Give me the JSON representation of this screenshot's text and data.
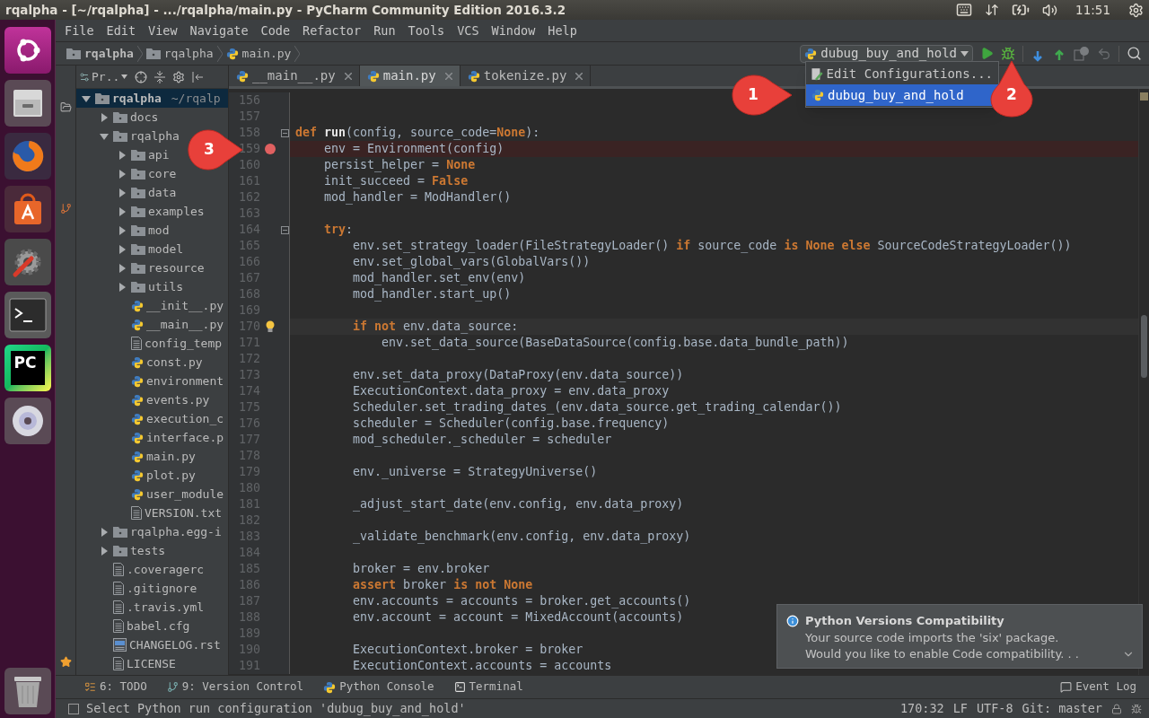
{
  "top_panel": {
    "title": "rqalpha - [~/rqalpha] - .../rqalpha/main.py - PyCharm Community Edition 2016.3.2",
    "clock": "11:51"
  },
  "launcher": {
    "items": [
      {
        "kind": "ubuntu"
      },
      {
        "kind": "files"
      },
      {
        "kind": "browser"
      },
      {
        "kind": "store"
      },
      {
        "kind": "settings"
      },
      {
        "kind": "terminal"
      },
      {
        "kind": "ide",
        "label": "PC"
      },
      {
        "kind": "disc"
      },
      {
        "kind": "trash"
      }
    ]
  },
  "menu": [
    "File",
    "Edit",
    "View",
    "Navigate",
    "Code",
    "Refactor",
    "Run",
    "Tools",
    "VCS",
    "Window",
    "Help"
  ],
  "breadcrumbs": [
    {
      "kind": "root",
      "label": "rqalpha"
    },
    {
      "kind": "folder",
      "label": "rqalpha"
    },
    {
      "kind": "python",
      "label": "main.py"
    }
  ],
  "run_config": {
    "label": "dubug_buy_and_hold"
  },
  "run_menu": [
    {
      "kind": "edit",
      "label": "Edit Configurations...",
      "selected": false
    },
    {
      "kind": "python",
      "label": "dubug_buy_and_hold",
      "selected": true
    }
  ],
  "project": {
    "header": "Pr..",
    "tree": [
      {
        "kind": "folder",
        "name": "rqalpha",
        "hint": "~/rqalp",
        "expanded": true,
        "selected": true,
        "children": [
          {
            "kind": "folder",
            "name": "docs",
            "expanded": false,
            "selected": false
          },
          {
            "kind": "folder",
            "name": "rqalpha",
            "expanded": true,
            "selected": false,
            "children": [
              {
                "kind": "folder",
                "name": "api",
                "expanded": false,
                "selected": false
              },
              {
                "kind": "folder",
                "name": "core",
                "expanded": false,
                "selected": false
              },
              {
                "kind": "folder",
                "name": "data",
                "expanded": false,
                "selected": false
              },
              {
                "kind": "folder",
                "name": "examples",
                "expanded": false,
                "selected": false
              },
              {
                "kind": "folder",
                "name": "mod",
                "expanded": false,
                "selected": false
              },
              {
                "kind": "folder",
                "name": "model",
                "expanded": false,
                "selected": false
              },
              {
                "kind": "folder",
                "name": "resource",
                "expanded": false,
                "selected": false
              },
              {
                "kind": "folder",
                "name": "utils",
                "expanded": false,
                "selected": false
              },
              {
                "kind": "python",
                "name": "__init__.py",
                "selected": false
              },
              {
                "kind": "python",
                "name": "__main__.py",
                "selected": false
              },
              {
                "kind": "text",
                "name": "config_temp",
                "selected": false
              },
              {
                "kind": "python",
                "name": "const.py",
                "selected": false
              },
              {
                "kind": "python",
                "name": "environment",
                "selected": false
              },
              {
                "kind": "python",
                "name": "events.py",
                "selected": false
              },
              {
                "kind": "python",
                "name": "execution_c",
                "selected": false
              },
              {
                "kind": "python",
                "name": "interface.p",
                "selected": false
              },
              {
                "kind": "python",
                "name": "main.py",
                "selected": false
              },
              {
                "kind": "python",
                "name": "plot.py",
                "selected": false
              },
              {
                "kind": "python",
                "name": "user_module",
                "selected": false
              },
              {
                "kind": "text",
                "name": "VERSION.txt",
                "selected": false
              }
            ]
          },
          {
            "kind": "folder",
            "name": "rqalpha.egg-i",
            "expanded": false,
            "selected": false
          },
          {
            "kind": "folder",
            "name": "tests",
            "expanded": false,
            "selected": false
          },
          {
            "kind": "text",
            "name": ".coveragerc",
            "selected": false
          },
          {
            "kind": "text",
            "name": ".gitignore",
            "selected": false
          },
          {
            "kind": "text",
            "name": ".travis.yml",
            "selected": false
          },
          {
            "kind": "text",
            "name": "babel.cfg",
            "selected": false
          },
          {
            "kind": "rst",
            "name": "CHANGELOG.rst",
            "selected": false
          },
          {
            "kind": "text",
            "name": "LICENSE",
            "selected": false
          }
        ]
      }
    ]
  },
  "tabs": [
    {
      "label": "__main__.py",
      "selected": false
    },
    {
      "label": "main.py",
      "selected": true
    },
    {
      "label": "tokenize.py",
      "selected": false
    }
  ],
  "editor": {
    "lines": [
      {
        "number": "156",
        "breakpoint": false,
        "caret": false,
        "fold": false
      },
      {
        "number": "157",
        "breakpoint": false,
        "caret": false,
        "fold": false
      },
      {
        "number": "158",
        "breakpoint": false,
        "caret": false,
        "fold": true,
        "tokens": [
          {
            "kind": "keyword",
            "text": "def "
          },
          {
            "kind": "name",
            "text": "run"
          },
          {
            "kind": "plain",
            "text": "(config, source_code="
          },
          {
            "kind": "keyword",
            "text": "None"
          },
          {
            "kind": "plain",
            "text": "):"
          }
        ]
      },
      {
        "number": "159",
        "breakpoint": true,
        "caret": false,
        "fold": false,
        "tokens": [
          {
            "kind": "plain",
            "text": "    env = Environment(config)"
          }
        ]
      },
      {
        "number": "160",
        "breakpoint": false,
        "caret": false,
        "fold": false,
        "tokens": [
          {
            "kind": "plain",
            "text": "    persist_helper = "
          },
          {
            "kind": "keyword",
            "text": "None"
          }
        ]
      },
      {
        "number": "161",
        "breakpoint": false,
        "caret": false,
        "fold": false,
        "tokens": [
          {
            "kind": "plain",
            "text": "    init_succeed = "
          },
          {
            "kind": "keyword",
            "text": "False"
          }
        ]
      },
      {
        "number": "162",
        "breakpoint": false,
        "caret": false,
        "fold": false,
        "tokens": [
          {
            "kind": "plain",
            "text": "    mod_handler = ModHandler()"
          }
        ]
      },
      {
        "number": "163",
        "breakpoint": false,
        "caret": false,
        "fold": false
      },
      {
        "number": "164",
        "breakpoint": false,
        "caret": false,
        "fold": true,
        "tokens": [
          {
            "kind": "keyword",
            "text": "    try"
          },
          {
            "kind": "plain",
            "text": ":"
          }
        ]
      },
      {
        "number": "165",
        "breakpoint": false,
        "caret": false,
        "fold": false,
        "tokens": [
          {
            "kind": "plain",
            "text": "        env.set_strategy_loader(FileStrategyLoader() "
          },
          {
            "kind": "keyword",
            "text": "if"
          },
          {
            "kind": "plain",
            "text": " source_code "
          },
          {
            "kind": "keyword",
            "text": "is None else"
          },
          {
            "kind": "plain",
            "text": " SourceCodeStrategyLoader())"
          }
        ]
      },
      {
        "number": "166",
        "breakpoint": false,
        "caret": false,
        "fold": false,
        "tokens": [
          {
            "kind": "plain",
            "text": "        env.set_global_vars(GlobalVars())"
          }
        ]
      },
      {
        "number": "167",
        "breakpoint": false,
        "caret": false,
        "fold": false,
        "tokens": [
          {
            "kind": "plain",
            "text": "        mod_handler.set_env(env)"
          }
        ]
      },
      {
        "number": "168",
        "breakpoint": false,
        "caret": false,
        "fold": false,
        "tokens": [
          {
            "kind": "plain",
            "text": "        mod_handler.start_up()"
          }
        ]
      },
      {
        "number": "169",
        "breakpoint": false,
        "caret": false,
        "fold": false
      },
      {
        "number": "170",
        "breakpoint": false,
        "caret": true,
        "fold": false,
        "tokens": [
          {
            "kind": "keyword",
            "text": "        if not"
          },
          {
            "kind": "plain",
            "text": " env.data_source:"
          }
        ]
      },
      {
        "number": "171",
        "breakpoint": false,
        "caret": false,
        "fold": false,
        "tokens": [
          {
            "kind": "plain",
            "text": "            env.set_data_source(BaseDataSource(config.base.data_bundle_path))"
          }
        ]
      },
      {
        "number": "172",
        "breakpoint": false,
        "caret": false,
        "fold": false
      },
      {
        "number": "173",
        "breakpoint": false,
        "caret": false,
        "fold": false,
        "tokens": [
          {
            "kind": "plain",
            "text": "        env.set_data_proxy(DataProxy(env.data_source))"
          }
        ]
      },
      {
        "number": "174",
        "breakpoint": false,
        "caret": false,
        "fold": false,
        "tokens": [
          {
            "kind": "plain",
            "text": "        ExecutionContext.data_proxy = env.data_proxy"
          }
        ]
      },
      {
        "number": "175",
        "breakpoint": false,
        "caret": false,
        "fold": false,
        "tokens": [
          {
            "kind": "plain",
            "text": "        Scheduler.set_trading_dates_(env.data_source.get_trading_calendar())"
          }
        ]
      },
      {
        "number": "176",
        "breakpoint": false,
        "caret": false,
        "fold": false,
        "tokens": [
          {
            "kind": "plain",
            "text": "        scheduler = Scheduler(config.base.frequency)"
          }
        ]
      },
      {
        "number": "177",
        "breakpoint": false,
        "caret": false,
        "fold": false,
        "tokens": [
          {
            "kind": "plain",
            "text": "        mod_scheduler._scheduler = scheduler"
          }
        ]
      },
      {
        "number": "178",
        "breakpoint": false,
        "caret": false,
        "fold": false
      },
      {
        "number": "179",
        "breakpoint": false,
        "caret": false,
        "fold": false,
        "tokens": [
          {
            "kind": "plain",
            "text": "        env._universe = StrategyUniverse()"
          }
        ]
      },
      {
        "number": "180",
        "breakpoint": false,
        "caret": false,
        "fold": false
      },
      {
        "number": "181",
        "breakpoint": false,
        "caret": false,
        "fold": false,
        "tokens": [
          {
            "kind": "plain",
            "text": "        _adjust_start_date(env.config, env.data_proxy)"
          }
        ]
      },
      {
        "number": "182",
        "breakpoint": false,
        "caret": false,
        "fold": false
      },
      {
        "number": "183",
        "breakpoint": false,
        "caret": false,
        "fold": false,
        "tokens": [
          {
            "kind": "plain",
            "text": "        _validate_benchmark(env.config, env.data_proxy)"
          }
        ]
      },
      {
        "number": "184",
        "breakpoint": false,
        "caret": false,
        "fold": false
      },
      {
        "number": "185",
        "breakpoint": false,
        "caret": false,
        "fold": false,
        "tokens": [
          {
            "kind": "plain",
            "text": "        broker = env.broker"
          }
        ]
      },
      {
        "number": "186",
        "breakpoint": false,
        "caret": false,
        "fold": false,
        "tokens": [
          {
            "kind": "keyword",
            "text": "        assert"
          },
          {
            "kind": "plain",
            "text": " broker "
          },
          {
            "kind": "keyword",
            "text": "is not None"
          }
        ]
      },
      {
        "number": "187",
        "breakpoint": false,
        "caret": false,
        "fold": false,
        "tokens": [
          {
            "kind": "plain",
            "text": "        env.accounts = accounts = broker.get_accounts()"
          }
        ]
      },
      {
        "number": "188",
        "breakpoint": false,
        "caret": false,
        "fold": false,
        "tokens": [
          {
            "kind": "plain",
            "text": "        env.account = account = MixedAccount(accounts)"
          }
        ]
      },
      {
        "number": "189",
        "breakpoint": false,
        "caret": false,
        "fold": false
      },
      {
        "number": "190",
        "breakpoint": false,
        "caret": false,
        "fold": false,
        "tokens": [
          {
            "kind": "plain",
            "text": "        ExecutionContext.broker = broker"
          }
        ]
      },
      {
        "number": "191",
        "breakpoint": false,
        "caret": false,
        "fold": false,
        "tokens": [
          {
            "kind": "plain",
            "text": "        ExecutionContext.accounts = accounts"
          }
        ]
      }
    ]
  },
  "notification": {
    "title": "Python Versions Compatibility",
    "body": [
      "Your source code imports the 'six' package.",
      "Would you like to enable Code compatibility. . ."
    ]
  },
  "tool_windows": [
    {
      "kind": "todo",
      "label": "6: TODO"
    },
    {
      "kind": "vcs",
      "label": "9: Version Control"
    },
    {
      "kind": "console",
      "label": "Python Console"
    },
    {
      "kind": "terminal",
      "label": "Terminal"
    }
  ],
  "event_log": {
    "label": "Event Log"
  },
  "status_bar": {
    "message": "Select Python run configuration 'dubug_buy_and_hold'",
    "position": "170:32",
    "line_separator": "LF",
    "encoding": "UTF-8",
    "branch": "Git: master"
  },
  "callouts": [
    {
      "label": "1"
    },
    {
      "label": "2"
    },
    {
      "label": "3"
    }
  ]
}
